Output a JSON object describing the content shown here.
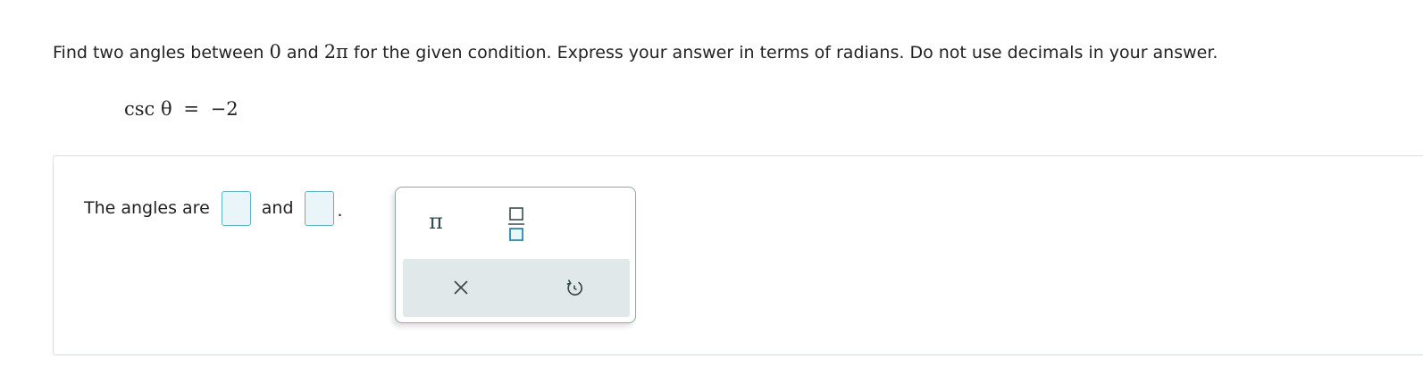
{
  "question": {
    "text_part1": "Find two angles between ",
    "zero": "0",
    "text_part2": " and ",
    "two_pi": "2π",
    "text_part3": " for the given condition. Express your answer in terms of radians. Do not use decimals in your answer."
  },
  "equation": {
    "lhs": "csc θ",
    "equals": "=",
    "rhs": "−2"
  },
  "answer": {
    "prefix": "The angles are",
    "connector": "and",
    "suffix": ".",
    "box1_value": "",
    "box2_value": ""
  },
  "palette": {
    "pi_symbol": "π",
    "fraction_icon": "fraction-icon",
    "clear_icon": "clear-x-icon",
    "undo_icon": "undo-icon"
  },
  "colors": {
    "input_border": "#5fb0c9",
    "input_fill": "#e9f5f8",
    "icon_teal": "#2a8aa8",
    "palette_bottom": "#e1e8ea"
  }
}
